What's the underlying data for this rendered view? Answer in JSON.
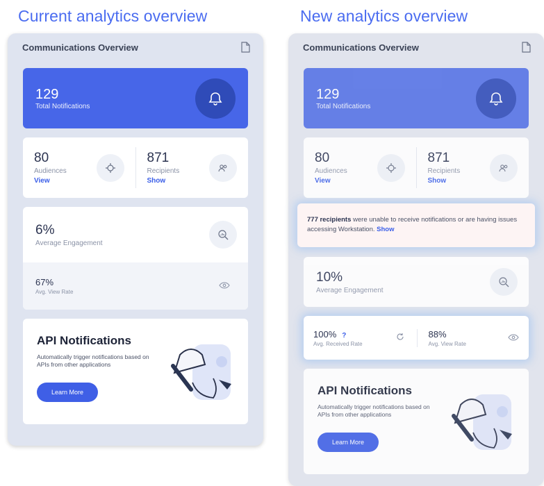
{
  "left": {
    "heading": "Current analytics overview",
    "panel_title": "Communications Overview",
    "total": {
      "value": "129",
      "label": "Total Notifications"
    },
    "audiences": {
      "value": "80",
      "label": "Audiences",
      "link": "View"
    },
    "recipients": {
      "value": "871",
      "label": "Recipients",
      "link": "Show"
    },
    "engagement": {
      "value": "6%",
      "label": "Average Engagement"
    },
    "view_rate": {
      "value": "67%",
      "label": "Avg. View Rate"
    },
    "api": {
      "title": "API Notifications",
      "desc": "Automatically trigger notifications based on APIs from other applications",
      "button": "Learn More"
    }
  },
  "right": {
    "heading": "New analytics overview",
    "panel_title": "Communications Overview",
    "total": {
      "value": "129",
      "label": "Total Notifications"
    },
    "audiences": {
      "value": "80",
      "label": "Audiences",
      "link": "View"
    },
    "recipients": {
      "value": "871",
      "label": "Recipients",
      "link": "Show"
    },
    "alert": {
      "count": "777 recipients",
      "text": " were unable to receive notifications or are having issues accessing Workstation. ",
      "link": "Show"
    },
    "engagement": {
      "value": "10%",
      "label": "Average Engagement"
    },
    "received_rate": {
      "value": "100%",
      "help": "?",
      "label": "Avg. Received Rate"
    },
    "view_rate": {
      "value": "88%",
      "label": "Avg. View Rate"
    },
    "api": {
      "title": "API Notifications",
      "desc": "Automatically trigger notifications based on APIs from other applications",
      "button": "Learn More"
    }
  },
  "colors": {
    "accent": "#4766e8",
    "link": "#3a5ee8",
    "alert_bg": "#fdf4f4"
  },
  "icons": [
    "document-icon",
    "bell-icon",
    "target-icon",
    "users-icon",
    "search-chart-icon",
    "eye-icon",
    "refresh-icon"
  ]
}
